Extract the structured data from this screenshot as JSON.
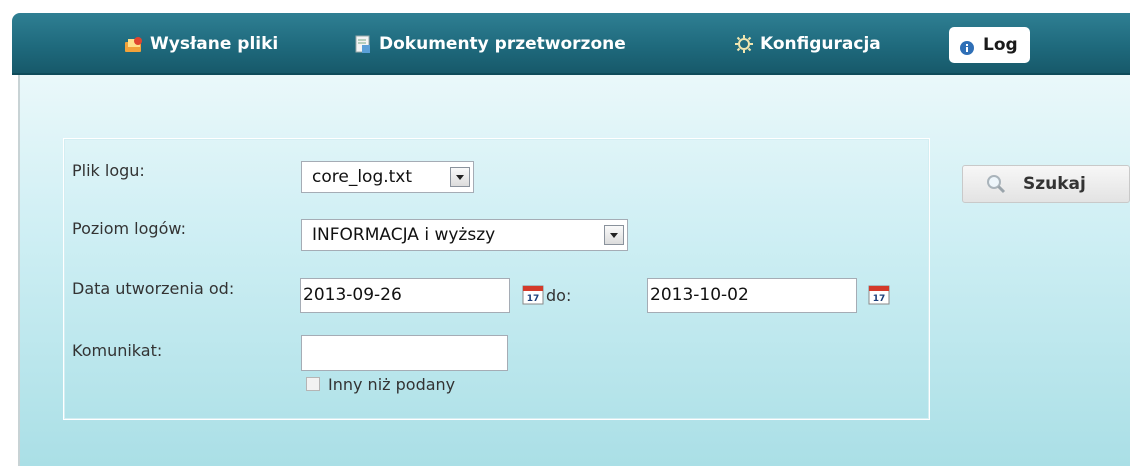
{
  "nav": {
    "items": [
      {
        "label": "Wysłane pliki",
        "icon": "upload-files-icon"
      },
      {
        "label": "Dokumenty przetworzone",
        "icon": "processed-document-icon"
      },
      {
        "label": "Konfiguracja",
        "icon": "gear-icon"
      },
      {
        "label": "Log",
        "icon": "info-icon",
        "active": true
      }
    ]
  },
  "form": {
    "log_file": {
      "label": "Plik logu:",
      "value": "core_log.txt"
    },
    "log_level": {
      "label": "Poziom logów:",
      "value": "INFORMACJA i wyższy"
    },
    "date_from": {
      "label": "Data utworzenia od:",
      "value": "2013-09-26"
    },
    "date_to": {
      "label": "do:",
      "value": "2013-10-02"
    },
    "message": {
      "label": "Komunikat:",
      "value": ""
    },
    "other_than": {
      "label": "Inny niż podany",
      "checked": false
    }
  },
  "search_button": {
    "label": "Szukaj",
    "icon": "search-icon"
  },
  "colors": {
    "nav_bar": "#1f6a7d",
    "panel_top": "#eaf8fa",
    "panel_bottom": "#aadfe6"
  }
}
